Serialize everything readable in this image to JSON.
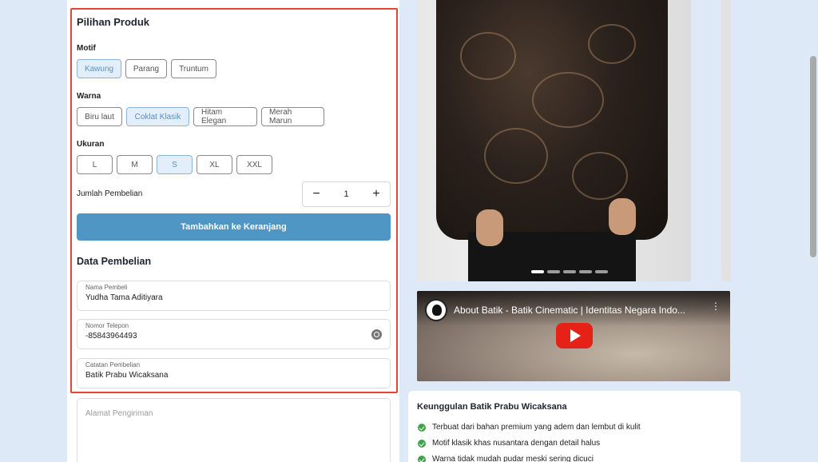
{
  "product_options": {
    "title": "Pilihan Produk",
    "motif": {
      "label": "Motif",
      "options": [
        "Kawung",
        "Parang",
        "Truntum"
      ],
      "selected": "Kawung"
    },
    "warna": {
      "label": "Warna",
      "options": [
        "Biru laut",
        "Coklat Klasik",
        "Hitam Elegan",
        "Merah Marun"
      ],
      "selected": "Coklat Klasik"
    },
    "ukuran": {
      "label": "Ukuran",
      "options": [
        "L",
        "M",
        "S",
        "XL",
        "XXL"
      ],
      "selected": "S"
    },
    "quantity": {
      "label": "Jumlah Pembelian",
      "minus": "−",
      "value": "1",
      "plus": "+"
    },
    "add_to_cart_label": "Tambahkan ke Keranjang"
  },
  "purchase_data": {
    "title": "Data Pembelian",
    "fields": {
      "name": {
        "label": "Nama Pembeli",
        "value": "Yudha Tama Aditiyara"
      },
      "phone": {
        "label": "Nomor Telepon",
        "value": "-85843964493"
      },
      "notes": {
        "label": "Catatan Pembelian",
        "value": "Batik Prabu Wicaksana"
      }
    },
    "address_placeholder": "Alamat Pengiriman"
  },
  "gallery": {
    "slide_count": 5,
    "active_slide": 1
  },
  "video": {
    "title": "About Batik - Batik Cinematic | Identitas Negara Indo...",
    "kebab": "⋮"
  },
  "benefits": {
    "title": "Keunggulan Batik Prabu Wicaksana",
    "items": [
      "Terbuat dari bahan premium yang adem dan lembut di kulit",
      "Motif klasik khas nusantara dengan detail halus",
      "Warna tidak mudah pudar meski sering dicuci"
    ]
  },
  "colors": {
    "primary_button": "#5096c5",
    "selected_chip_bg": "#e3eefb",
    "highlight_border": "#e0473a",
    "check_green": "#3fa34a",
    "page_bg": "#dde9f7"
  }
}
